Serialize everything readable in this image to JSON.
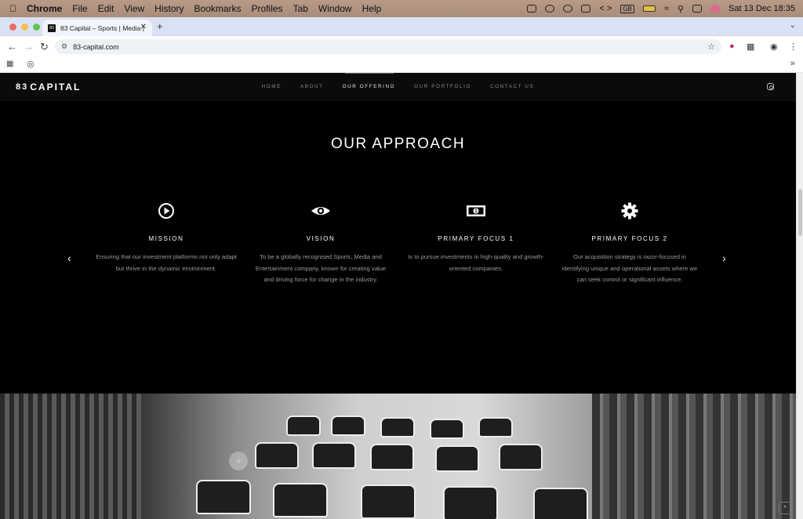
{
  "mac_menubar": {
    "app": "Chrome",
    "menus": [
      "File",
      "Edit",
      "View",
      "History",
      "Bookmarks",
      "Profiles",
      "Tab",
      "Window",
      "Help"
    ],
    "keyboard": "GB",
    "clock": "Sat 13 Dec  18:35"
  },
  "browser": {
    "tab_title": "83 Capital – Sports | Media | ",
    "favicon_text": "83",
    "url": "83-capital.com"
  },
  "site": {
    "logo_mark": "83",
    "logo_text": "CAPITAL",
    "nav": [
      {
        "label": "HOME"
      },
      {
        "label": "ABOUT"
      },
      {
        "label": "OUR OFFERING"
      },
      {
        "label": "OUR PORTFOLIO"
      },
      {
        "label": "CONTACT US"
      }
    ],
    "active_nav": "OUR OFFERING",
    "section_title": "OUR APPROACH",
    "cards": [
      {
        "icon": "play-circle-icon",
        "title": "MISSION",
        "desc": "Ensuring that our investment platforms not only adapt but thrive in the dynamic environment."
      },
      {
        "icon": "eye-icon",
        "title": "VISION",
        "desc": "To be a globally recognised Sports, Media and Entertainment company, known for creating value and driving force for change in the industry."
      },
      {
        "icon": "banknote-icon",
        "title": "PRIMARY FOCUS 1",
        "desc": "Is to pursue investments in high-quality and growth-oriented companies."
      },
      {
        "icon": "gear-icon",
        "title": "PRIMARY FOCUS 2",
        "desc": "Our acquisition strategy is razor-focused in identifying unique and operational assets where we can seek control or significant influence."
      }
    ]
  },
  "colors": {
    "page_bg": "#000000",
    "header_bg": "#0b0b0b",
    "body_text": "#9a9a9a",
    "heading_text": "#ffffff"
  }
}
